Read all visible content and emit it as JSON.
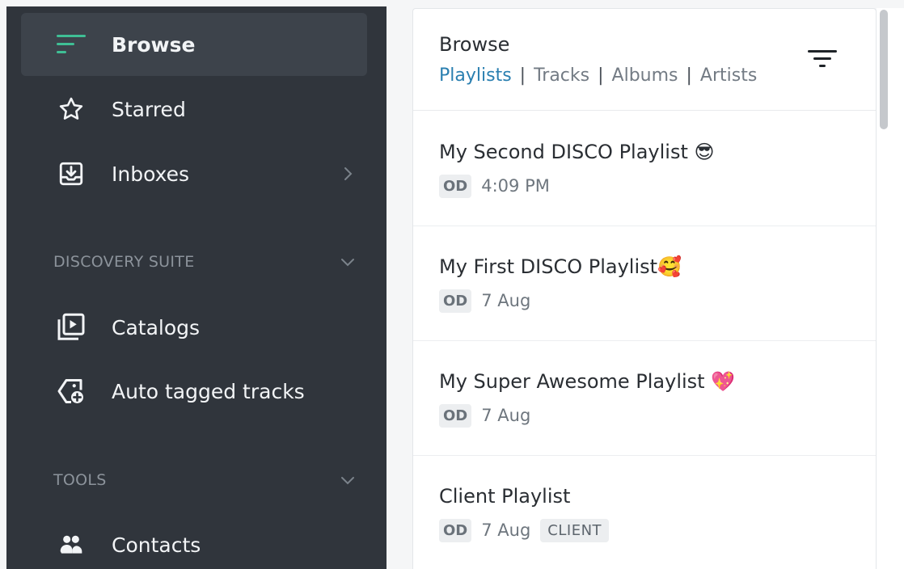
{
  "sidebar": {
    "items": [
      {
        "label": "Browse",
        "icon": "browse-icon"
      },
      {
        "label": "Starred",
        "icon": "star-icon"
      },
      {
        "label": "Inboxes",
        "icon": "inbox-icon"
      }
    ],
    "sections": [
      {
        "label": "DISCOVERY SUITE",
        "items": [
          {
            "label": "Catalogs",
            "icon": "catalog-icon"
          },
          {
            "label": "Auto tagged tracks",
            "icon": "auto-tag-icon"
          }
        ]
      },
      {
        "label": "TOOLS",
        "items": [
          {
            "label": "Contacts",
            "icon": "contacts-icon"
          }
        ]
      }
    ]
  },
  "panel": {
    "title": "Browse",
    "tabs": [
      "Playlists",
      "Tracks",
      "Albums",
      "Artists"
    ],
    "active_tab": "Playlists",
    "separator": "|"
  },
  "playlists": [
    {
      "title": "My Second DISCO Playlist ",
      "emoji": "😎",
      "owner": "OD",
      "date": "4:09 PM"
    },
    {
      "title": "My First DISCO Playlist",
      "emoji": "🥰",
      "owner": "OD",
      "date": "7 Aug"
    },
    {
      "title": "My Super Awesome Playlist ",
      "emoji": "💖",
      "owner": "OD",
      "date": "7 Aug"
    },
    {
      "title": "Client Playlist",
      "emoji": "",
      "owner": "OD",
      "date": "7 Aug",
      "tag": "CLIENT"
    }
  ],
  "colors": {
    "sidebar_bg": "#30353c",
    "active_item_bg": "#3d434b",
    "accent": "#2a7fb0",
    "browse_icon": "#3fbf95"
  }
}
